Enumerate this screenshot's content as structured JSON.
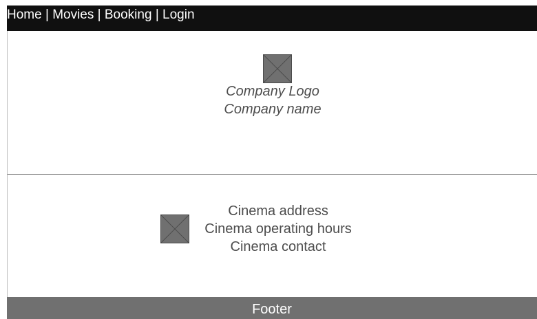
{
  "nav": {
    "items": [
      {
        "label": "Home"
      },
      {
        "label": "Movies"
      },
      {
        "label": "Booking"
      },
      {
        "label": "Login"
      }
    ],
    "separator": " | "
  },
  "hero": {
    "logo_icon": "image-placeholder-icon",
    "logo_label": "Company Logo",
    "company_name": "Company name"
  },
  "cinema": {
    "image_icon": "image-placeholder-icon",
    "address": "Cinema address",
    "hours": "Cinema operating hours",
    "contact": "Cinema contact"
  },
  "footer": {
    "label": "Footer"
  },
  "colors": {
    "topbar_bg": "#101010",
    "footer_bg": "#707070",
    "placeholder_fill": "#707070",
    "text_gray": "#4d4d4d"
  }
}
